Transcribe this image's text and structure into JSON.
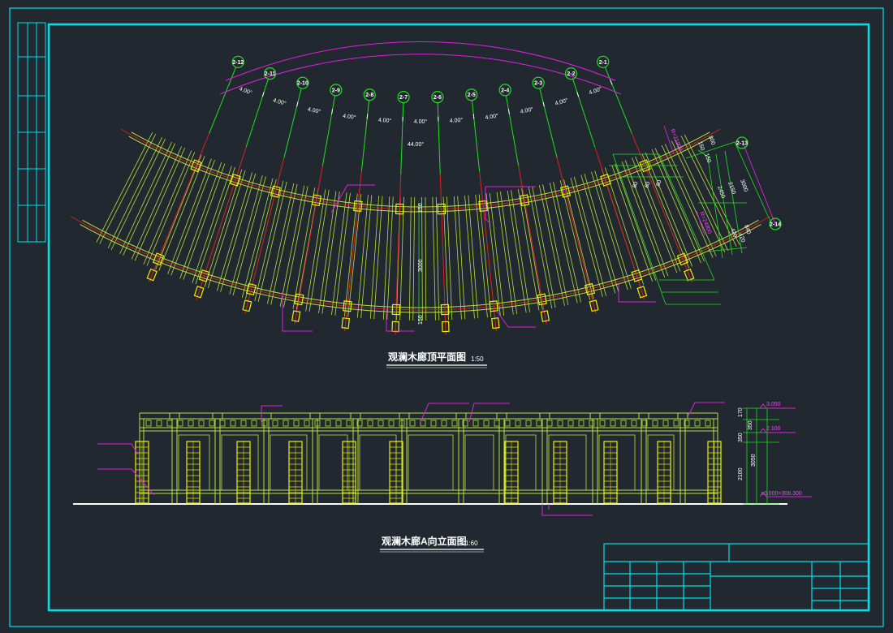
{
  "colors": {
    "background": "#212830",
    "frame": "#00e0e8",
    "grid_red": "#e02020",
    "grid_green": "#20e020",
    "dimension_magenta": "#e020e0",
    "timber": "#b8e040",
    "post_yellow": "#f0f000",
    "text": "#ffffff"
  },
  "plan": {
    "title": "观澜木廊顶平面图",
    "scale": "1:50",
    "axis_labels": [
      "2-1",
      "2-2",
      "2-3",
      "2-4",
      "2-5",
      "2-6",
      "2-7",
      "2-8",
      "2-9",
      "2-10",
      "2-11",
      "2-12"
    ],
    "angle_labels": [
      "4.00°",
      "4.00°",
      "4.00°",
      "4.00°",
      "4.00°",
      "4.00°",
      "4.00°",
      "4.00°",
      "4.00°",
      "4.00°",
      "4.00°"
    ],
    "total_angle": "44.00°",
    "center_depth": "3000",
    "top_offset": "150",
    "bottom_offset": "150",
    "right_axis_top": "2-13",
    "right_axis_bottom": "2-14",
    "right_dims": {
      "r1": "R=21900",
      "r2": "R=24900",
      "a": "300",
      "b": "150",
      "c": "150",
      "d": "2450",
      "e": "2150",
      "f": "3000",
      "g": "420",
      "h": "420",
      "i": "840",
      "s1": "80",
      "s2": "80",
      "s3": "80"
    }
  },
  "elevation": {
    "title": "观澜木廊A向立面图",
    "scale": "1:60",
    "level_top": "3.050",
    "level_mid": "2.100",
    "level_ground": "±0.000=308.300",
    "dims": {
      "d1": "170",
      "d2": "350",
      "d3": "350",
      "d4": "3050",
      "d5": "2100"
    }
  }
}
